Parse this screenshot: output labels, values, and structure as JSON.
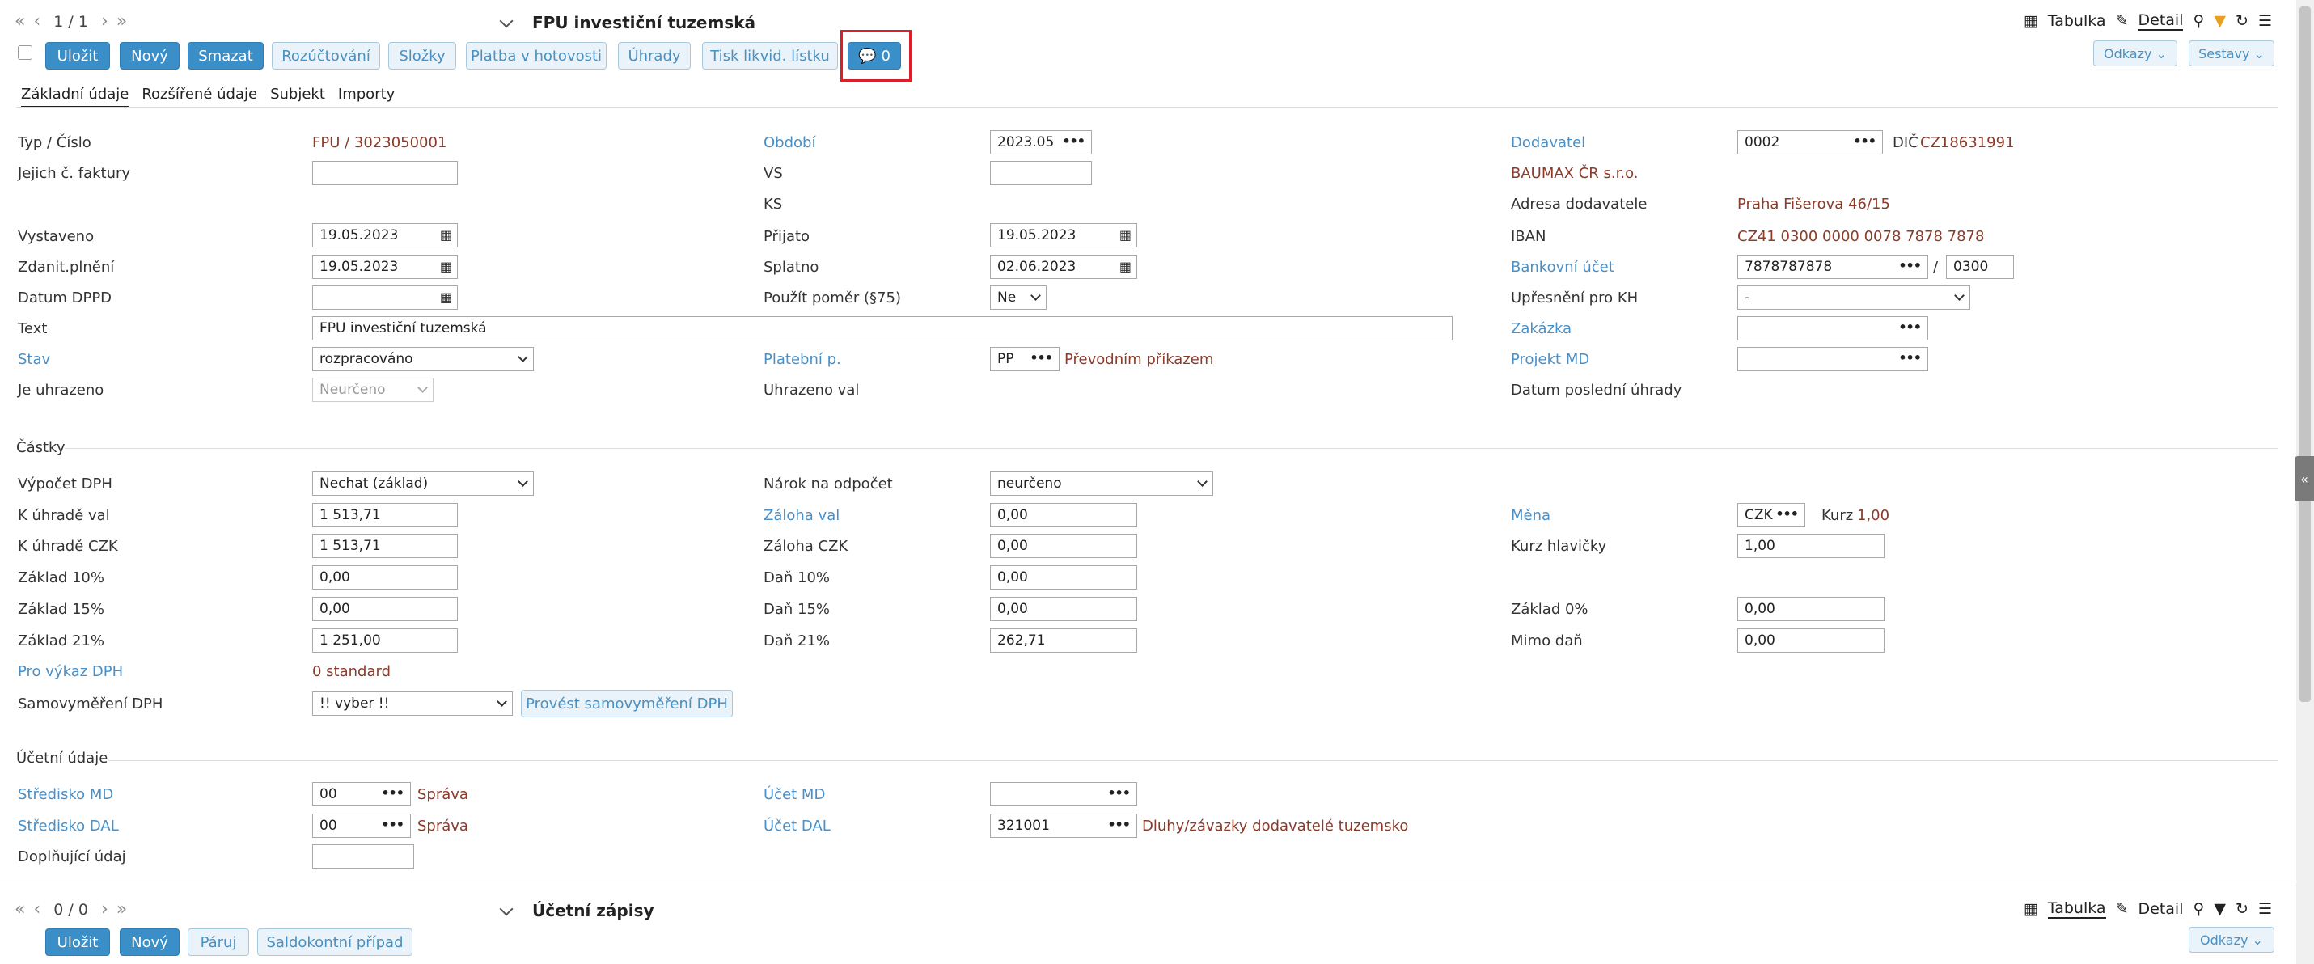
{
  "top": {
    "nav_first": "«",
    "nav_prev": "‹",
    "page": "1 / 1",
    "nav_next": "›",
    "nav_last": "»",
    "title": "FPU investiční tuzemská",
    "buttons": {
      "save": "Uložit",
      "new": "Nový",
      "delete": "Smazat",
      "alloc": "Rozúčtování",
      "folders": "Složky",
      "cash": "Platba v hotovosti",
      "payments": "Úhrady",
      "print": "Tisk likvid. lístku",
      "comments": "0"
    },
    "view_table": "Tabulka",
    "view_detail": "Detail",
    "links": "Odkazy",
    "reports": "Sestavy"
  },
  "tabs": [
    "Základní údaje",
    "Rozšířené údaje",
    "Subjekt",
    "Importy"
  ],
  "left": {
    "typ_label": "Typ / Číslo",
    "typ_value": "FPU / 3023050001",
    "jejich_label": "Jejich č. faktury",
    "jejich_value": "",
    "vystaveno_label": "Vystaveno",
    "vystaveno_value": "19.05.2023",
    "zdanit_label": "Zdanit.plnění",
    "zdanit_value": "19.05.2023",
    "dppd_label": "Datum DPPD",
    "dppd_value": "",
    "text_label": "Text",
    "text_value": "FPU investiční tuzemská",
    "stav_label": "Stav",
    "stav_value": "rozpracováno",
    "uhrazeno_label": "Je uhrazeno",
    "uhrazeno_value": "Neurčeno"
  },
  "mid": {
    "obdobi_label": "Období",
    "obdobi_value": "2023.05",
    "vs_label": "VS",
    "vs_value": "",
    "ks_label": "KS",
    "prijato_label": "Přijato",
    "prijato_value": "19.05.2023",
    "splatno_label": "Splatno",
    "splatno_value": "02.06.2023",
    "pomer_label": "Použít poměr (§75)",
    "pomer_value": "Ne",
    "platebni_label": "Platební p.",
    "platebni_value": "PP",
    "platebni_text": "Převodním příkazem",
    "uhrazeno_val_label": "Uhrazeno val"
  },
  "right": {
    "dodavatel_label": "Dodavatel",
    "dodavatel_value": "0002",
    "dic_label": "DIČ",
    "dic_value": "CZ18631991",
    "dodavatel_name": "BAUMAX ČR s.r.o.",
    "adresa_label": "Adresa dodavatele",
    "adresa_value": "Praha  Fišerova 46/15",
    "iban_label": "IBAN",
    "iban_value": "CZ41 0300 0000 0078 7878 7878",
    "ucet_label": "Bankovní účet",
    "ucet_value": "7878787878",
    "ucet_sep": "/",
    "ucet_bank": "0300",
    "upres_label": "Upřesnění pro KH",
    "upres_value": "-",
    "zakazka_label": "Zakázka",
    "zakazka_value": "",
    "projekt_label": "Projekt MD",
    "projekt_value": "",
    "posledni_label": "Datum poslední úhrady"
  },
  "castky": {
    "title": "Částky",
    "vypocet_label": "Výpočet DPH",
    "vypocet_value": "Nechat (základ)",
    "kuhrade_val_label": "K úhradě val",
    "kuhrade_val_value": "1 513,71",
    "kuhrade_czk_label": "K úhradě CZK",
    "kuhrade_czk_value": "1 513,71",
    "z10_label": "Základ 10%",
    "z10_value": "0,00",
    "z15_label": "Základ 15%",
    "z15_value": "0,00",
    "z21_label": "Základ 21%",
    "z21_value": "1 251,00",
    "vykaz_label": "Pro výkaz DPH",
    "vykaz_value": "0 standard",
    "samo_label": "Samovyměření DPH",
    "samo_value": "!! vyber !!",
    "samo_btn": "Provést samovyměření DPH",
    "narok_label": "Nárok na odpočet",
    "narok_value": "neurčeno",
    "zaloha_val_label": "Záloha val",
    "zaloha_val_value": "0,00",
    "zaloha_czk_label": "Záloha CZK",
    "zaloha_czk_value": "0,00",
    "d10_label": "Daň 10%",
    "d10_value": "0,00",
    "d15_label": "Daň 15%",
    "d15_value": "0,00",
    "d21_label": "Daň 21%",
    "d21_value": "262,71",
    "mena_label": "Měna",
    "mena_value": "CZK",
    "kurz_label": "Kurz",
    "kurz_value": "1,00",
    "kurzh_label": "Kurz hlavičky",
    "kurzh_value": "1,00",
    "z0_label": "Základ 0%",
    "z0_value": "0,00",
    "mimo_label": "Mimo daň",
    "mimo_value": "0,00"
  },
  "ucetni": {
    "title": "Účetní údaje",
    "smd_label": "Středisko MD",
    "smd_value": "00",
    "smd_text": "Správa",
    "sdal_label": "Středisko DAL",
    "sdal_value": "00",
    "sdal_text": "Správa",
    "dopl_label": "Doplňující údaj",
    "dopl_value": "",
    "umd_label": "Účet MD",
    "umd_value": "",
    "udal_label": "Účet DAL",
    "udal_value": "321001",
    "udal_text": "Dluhy/závazky dodavatelé tuzemsko"
  },
  "bottom": {
    "page": "0 / 0",
    "title": "Účetní zápisy",
    "save": "Uložit",
    "new": "Nový",
    "pair": "Páruj",
    "saldo": "Saldokontní případ",
    "view_table": "Tabulka",
    "view_detail": "Detail",
    "links": "Odkazy"
  },
  "colors": {
    "primary": "#3b8fc8",
    "link": "#4a8fc5",
    "value": "#8a3b2a",
    "highlight": "#d9202a"
  }
}
